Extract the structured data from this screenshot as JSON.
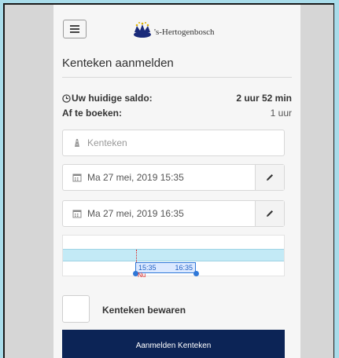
{
  "header": {
    "logo_text": "'s-Hertogenbosch"
  },
  "page": {
    "title": "Kenteken aanmelden"
  },
  "balance": {
    "label": "Uw huidige saldo:",
    "value": "2 uur 52 min"
  },
  "deduct": {
    "label": "Af te boeken:",
    "value": "1 uur"
  },
  "plate": {
    "placeholder": "Kenteken"
  },
  "start": {
    "value": "Ma 27 mei, 2019 15:35"
  },
  "end": {
    "value": "Ma 27 mei, 2019 16:35"
  },
  "timeline": {
    "start_label": "15:35",
    "end_label": "16:35",
    "now_label": "Nu"
  },
  "save_plate": {
    "label": "Kenteken bewaren",
    "checked": false
  },
  "submit": {
    "label": "Aanmelden Kenteken"
  },
  "colors": {
    "primary": "#0c2456",
    "accent": "#2f78d8",
    "now": "#dd2222",
    "band": "#c3eaf6"
  }
}
